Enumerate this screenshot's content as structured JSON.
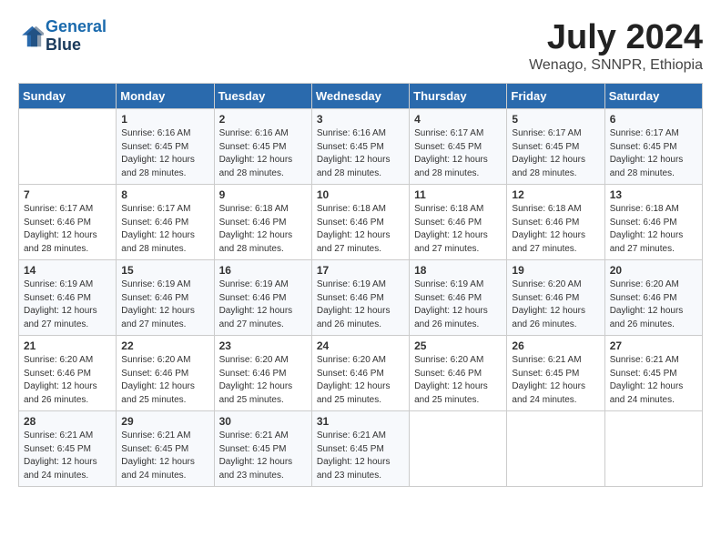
{
  "header": {
    "logo_line1": "General",
    "logo_line2": "Blue",
    "month_title": "July 2024",
    "location": "Wenago, SNNPR, Ethiopia"
  },
  "days_of_week": [
    "Sunday",
    "Monday",
    "Tuesday",
    "Wednesday",
    "Thursday",
    "Friday",
    "Saturday"
  ],
  "weeks": [
    [
      {
        "day": "",
        "sunrise": "",
        "sunset": "",
        "daylight": ""
      },
      {
        "day": "1",
        "sunrise": "Sunrise: 6:16 AM",
        "sunset": "Sunset: 6:45 PM",
        "daylight": "Daylight: 12 hours and 28 minutes."
      },
      {
        "day": "2",
        "sunrise": "Sunrise: 6:16 AM",
        "sunset": "Sunset: 6:45 PM",
        "daylight": "Daylight: 12 hours and 28 minutes."
      },
      {
        "day": "3",
        "sunrise": "Sunrise: 6:16 AM",
        "sunset": "Sunset: 6:45 PM",
        "daylight": "Daylight: 12 hours and 28 minutes."
      },
      {
        "day": "4",
        "sunrise": "Sunrise: 6:17 AM",
        "sunset": "Sunset: 6:45 PM",
        "daylight": "Daylight: 12 hours and 28 minutes."
      },
      {
        "day": "5",
        "sunrise": "Sunrise: 6:17 AM",
        "sunset": "Sunset: 6:45 PM",
        "daylight": "Daylight: 12 hours and 28 minutes."
      },
      {
        "day": "6",
        "sunrise": "Sunrise: 6:17 AM",
        "sunset": "Sunset: 6:45 PM",
        "daylight": "Daylight: 12 hours and 28 minutes."
      }
    ],
    [
      {
        "day": "7",
        "sunrise": "Sunrise: 6:17 AM",
        "sunset": "Sunset: 6:46 PM",
        "daylight": "Daylight: 12 hours and 28 minutes."
      },
      {
        "day": "8",
        "sunrise": "Sunrise: 6:17 AM",
        "sunset": "Sunset: 6:46 PM",
        "daylight": "Daylight: 12 hours and 28 minutes."
      },
      {
        "day": "9",
        "sunrise": "Sunrise: 6:18 AM",
        "sunset": "Sunset: 6:46 PM",
        "daylight": "Daylight: 12 hours and 28 minutes."
      },
      {
        "day": "10",
        "sunrise": "Sunrise: 6:18 AM",
        "sunset": "Sunset: 6:46 PM",
        "daylight": "Daylight: 12 hours and 27 minutes."
      },
      {
        "day": "11",
        "sunrise": "Sunrise: 6:18 AM",
        "sunset": "Sunset: 6:46 PM",
        "daylight": "Daylight: 12 hours and 27 minutes."
      },
      {
        "day": "12",
        "sunrise": "Sunrise: 6:18 AM",
        "sunset": "Sunset: 6:46 PM",
        "daylight": "Daylight: 12 hours and 27 minutes."
      },
      {
        "day": "13",
        "sunrise": "Sunrise: 6:18 AM",
        "sunset": "Sunset: 6:46 PM",
        "daylight": "Daylight: 12 hours and 27 minutes."
      }
    ],
    [
      {
        "day": "14",
        "sunrise": "Sunrise: 6:19 AM",
        "sunset": "Sunset: 6:46 PM",
        "daylight": "Daylight: 12 hours and 27 minutes."
      },
      {
        "day": "15",
        "sunrise": "Sunrise: 6:19 AM",
        "sunset": "Sunset: 6:46 PM",
        "daylight": "Daylight: 12 hours and 27 minutes."
      },
      {
        "day": "16",
        "sunrise": "Sunrise: 6:19 AM",
        "sunset": "Sunset: 6:46 PM",
        "daylight": "Daylight: 12 hours and 27 minutes."
      },
      {
        "day": "17",
        "sunrise": "Sunrise: 6:19 AM",
        "sunset": "Sunset: 6:46 PM",
        "daylight": "Daylight: 12 hours and 26 minutes."
      },
      {
        "day": "18",
        "sunrise": "Sunrise: 6:19 AM",
        "sunset": "Sunset: 6:46 PM",
        "daylight": "Daylight: 12 hours and 26 minutes."
      },
      {
        "day": "19",
        "sunrise": "Sunrise: 6:20 AM",
        "sunset": "Sunset: 6:46 PM",
        "daylight": "Daylight: 12 hours and 26 minutes."
      },
      {
        "day": "20",
        "sunrise": "Sunrise: 6:20 AM",
        "sunset": "Sunset: 6:46 PM",
        "daylight": "Daylight: 12 hours and 26 minutes."
      }
    ],
    [
      {
        "day": "21",
        "sunrise": "Sunrise: 6:20 AM",
        "sunset": "Sunset: 6:46 PM",
        "daylight": "Daylight: 12 hours and 26 minutes."
      },
      {
        "day": "22",
        "sunrise": "Sunrise: 6:20 AM",
        "sunset": "Sunset: 6:46 PM",
        "daylight": "Daylight: 12 hours and 25 minutes."
      },
      {
        "day": "23",
        "sunrise": "Sunrise: 6:20 AM",
        "sunset": "Sunset: 6:46 PM",
        "daylight": "Daylight: 12 hours and 25 minutes."
      },
      {
        "day": "24",
        "sunrise": "Sunrise: 6:20 AM",
        "sunset": "Sunset: 6:46 PM",
        "daylight": "Daylight: 12 hours and 25 minutes."
      },
      {
        "day": "25",
        "sunrise": "Sunrise: 6:20 AM",
        "sunset": "Sunset: 6:46 PM",
        "daylight": "Daylight: 12 hours and 25 minutes."
      },
      {
        "day": "26",
        "sunrise": "Sunrise: 6:21 AM",
        "sunset": "Sunset: 6:45 PM",
        "daylight": "Daylight: 12 hours and 24 minutes."
      },
      {
        "day": "27",
        "sunrise": "Sunrise: 6:21 AM",
        "sunset": "Sunset: 6:45 PM",
        "daylight": "Daylight: 12 hours and 24 minutes."
      }
    ],
    [
      {
        "day": "28",
        "sunrise": "Sunrise: 6:21 AM",
        "sunset": "Sunset: 6:45 PM",
        "daylight": "Daylight: 12 hours and 24 minutes."
      },
      {
        "day": "29",
        "sunrise": "Sunrise: 6:21 AM",
        "sunset": "Sunset: 6:45 PM",
        "daylight": "Daylight: 12 hours and 24 minutes."
      },
      {
        "day": "30",
        "sunrise": "Sunrise: 6:21 AM",
        "sunset": "Sunset: 6:45 PM",
        "daylight": "Daylight: 12 hours and 23 minutes."
      },
      {
        "day": "31",
        "sunrise": "Sunrise: 6:21 AM",
        "sunset": "Sunset: 6:45 PM",
        "daylight": "Daylight: 12 hours and 23 minutes."
      },
      {
        "day": "",
        "sunrise": "",
        "sunset": "",
        "daylight": ""
      },
      {
        "day": "",
        "sunrise": "",
        "sunset": "",
        "daylight": ""
      },
      {
        "day": "",
        "sunrise": "",
        "sunset": "",
        "daylight": ""
      }
    ]
  ]
}
